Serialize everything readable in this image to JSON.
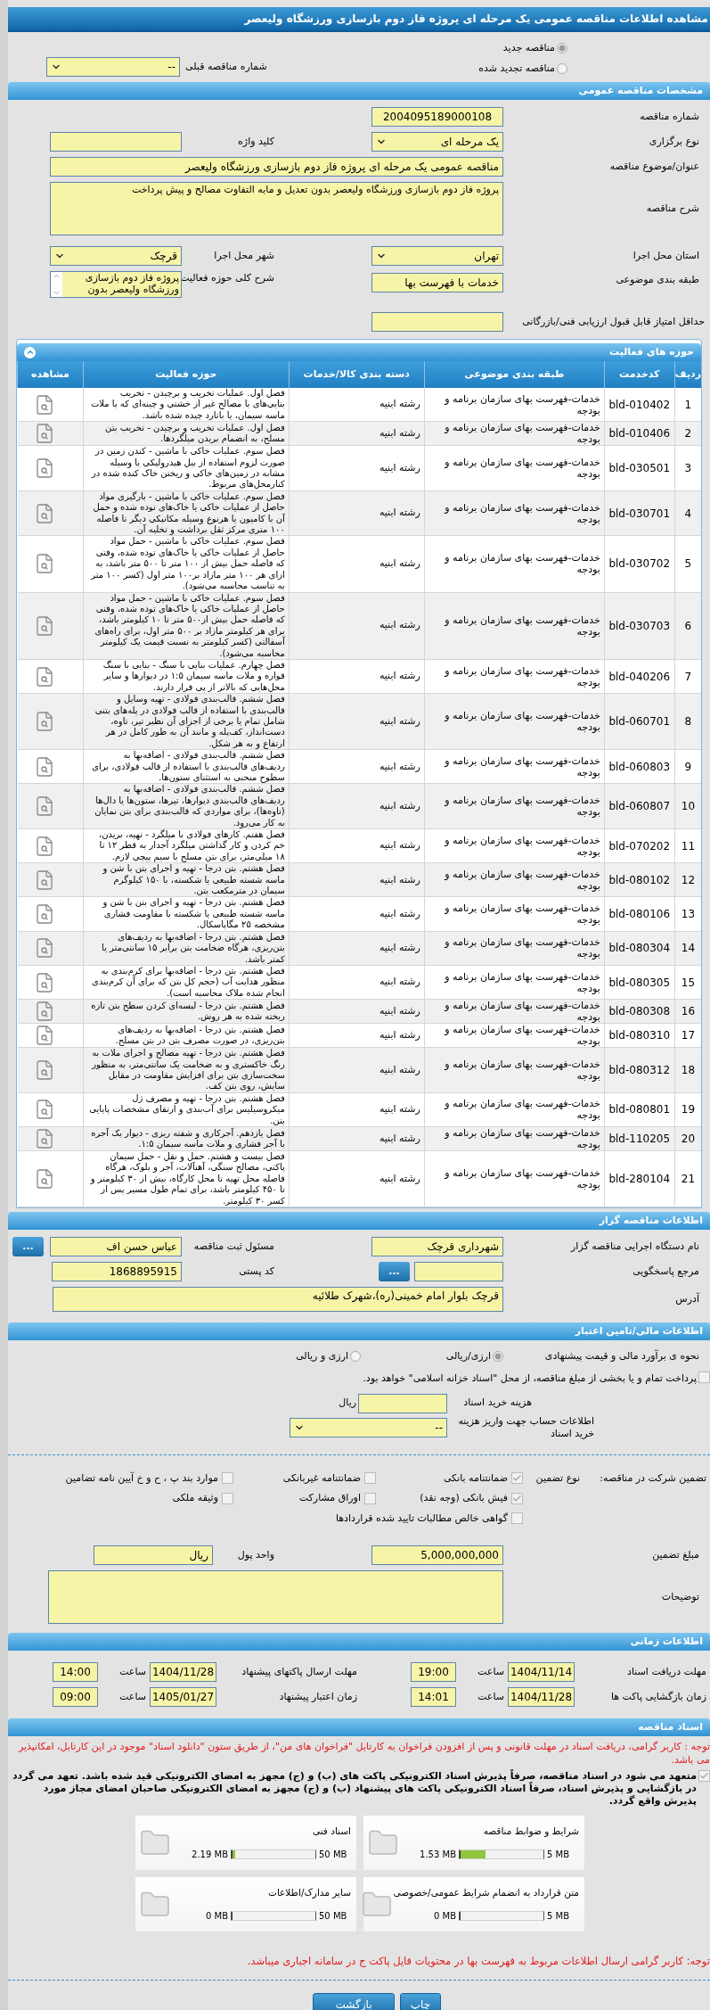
{
  "page_title": "مشاهده اطلاعات مناقصه عمومی یک مرحله ای پروژه فاز دوم بازسازی ورزشگاه ولیعصر",
  "tender_type": {
    "options": [
      {
        "label": "مناقصه جدید",
        "selected": true
      },
      {
        "label": "مناقصه تجدید شده",
        "selected": false
      }
    ],
    "previous": {
      "label": "شماره مناقصه قبلی",
      "value": "--"
    }
  },
  "general": {
    "title": "مشخصات مناقصه عمومی",
    "tender_number": {
      "label": "شماره مناقصه",
      "value": "2004095189000108"
    },
    "holding_type": {
      "label": "نوع برگزاری",
      "value": "یک مرحله ای"
    },
    "keyword": {
      "label": "کلید واژه"
    },
    "subject": {
      "label": "عنوان/موضوع مناقصه",
      "value": "مناقصه عمومی یک مرحله ای پروژه فاز دوم بازسازی ورزشگاه ولیعصر"
    },
    "description": {
      "label": "شرح مناقصه",
      "value": "پروژه فاز دوم بازسازی ورزشگاه ولیعصر بدون تعدیل و مابه التفاوت مصالح و پیش پرداخت"
    },
    "province": {
      "label": "استان محل اجرا",
      "value": "تهران"
    },
    "city": {
      "label": "شهر محل اجرا",
      "value": "قرچک"
    },
    "category": {
      "label": "طبقه بندی موضوعی",
      "value": "خدمات با فهرست بها"
    },
    "scope": {
      "label": "شرح کلی حوزه فعالیت",
      "value": "پروژه فاز دوم بازسازی ورزشگاه ولیعصر بدون"
    },
    "min_score": {
      "label": "حداقل امتیاز قابل قبول ارزیابی فنی/بازرگانی"
    }
  },
  "activities": {
    "title": "حوزه های فعالیت",
    "columns": [
      "ردیف",
      "کدخدمت",
      "طبقه بندی موضوعی",
      "دسته بندی کالا/خدمات",
      "حوزه فعالیت",
      "مشاهده"
    ],
    "rows": [
      [
        "1",
        "bld-010402",
        "خدمات-فهرست بهای سازمان برنامه و بودجه",
        "رشته ابنیه",
        "فصل اول. عملیات تخریب و برچیدن - تخریب بنایی‌های با مصالح غیر از خشتی و چینه‌ای که با ملات ماسه سیمان، یا باتارد چیده شده باشد."
      ],
      [
        "2",
        "bld-010406",
        "خدمات-فهرست بهای سازمان برنامه و بودجه",
        "رشته ابنیه",
        "فصل اول. عملیات تخریب و برچیدن - تخریب بتن مسلح، به انضمام بریدن میلگردها."
      ],
      [
        "3",
        "bld-030501",
        "خدمات-فهرست بهای سازمان برنامه و بودجه",
        "رشته ابنیه",
        "فصل سوم. عملیات خاکی با ماشین - کندن زمین در صورت لزوم استفاده از بیل هیدرولیکی یا  وسیله مشابه در زمین‌های خاکی و ریختن خاک کنده شده در کنارمحل‌های مربوط."
      ],
      [
        "4",
        "bld-030701",
        "خدمات-فهرست بهای سازمان برنامه و بودجه",
        "رشته ابنیه",
        "فصل سوم. عملیات خاکی با ماشین - بارگیری مواد حاصل از عملیات خاکی یا خاک‌های توده شده و حمل آن با کامیون یا هرنوع وسیله مکانیکی دیگر تا فاصله ۱۰۰ متری مرکز ثقل  برداشت و تخلیه آن."
      ],
      [
        "5",
        "bld-030702",
        "خدمات-فهرست بهای سازمان برنامه و بودجه",
        "رشته ابنیه",
        "فصل سوم. عملیات خاکی با ماشین - حمل مواد حاصل از عملیات خاکی یا خاک‌های توده شده، وقتی که فاصله حمل بیش از ۱۰۰ متر تا ۵۰۰ متر باشد، به ازای هر ۱۰۰ متر مازاد بر۱۰۰ متر اول (کسر ۱۰۰ متر به تناسب محاسبه می‌شود)."
      ],
      [
        "6",
        "bld-030703",
        "خدمات-فهرست بهای سازمان برنامه و بودجه",
        "رشته ابنیه",
        "فصل سوم. عملیات خاکی با ماشین - حمل مواد حاصل از عملیات خاکی یا خاک‌های توده شده، وقتی  که فاصله حمل بیش از۵۰۰ متر تا ۱۰ کیلومتر باشد، برای هر کیلومتر مازاد بر ۵۰۰  متر اول، برای راه‌های آسفالتی (کسر کیلومتر به نسبت قیمت یک کیلومتر محاسبه می‌شود)."
      ],
      [
        "7",
        "bld-040206",
        "خدمات-فهرست بهای سازمان برنامه و بودجه",
        "رشته ابنیه",
        "فصل چهارم. عملیات بنایی با سنگ - بنایی با سنگ قواره و ملات ماسه سیمان ۱:۵ در دیوارها و سایر محل‌هایی که بالاتر از پی قرار دارند."
      ],
      [
        "8",
        "bld-060701",
        "خدمات-فهرست بهای سازمان برنامه و بودجه",
        "رشته ابنیه",
        "فصل ششم. قالب‌بندی فولادی - تهیه وسایل و قالب‌بندی با استفاده از قالب فولادی در پله‌های بتنی شامل تمام یا برخی از اجزای آن نظیر تیر، تاوه، دست‌انداز، کف‌پله و مانند آن به طور کامل در هر ارتفاع و به هر شکل."
      ],
      [
        "9",
        "bld-060803",
        "خدمات-فهرست بهای سازمان برنامه و بودجه",
        "رشته ابنیه",
        "فصل ششم. قالب‌بندی فولادی - اضافه‌بها به ردیف‌های قالب‌بندی با استفاده از قالب فولادی، برای سطوح منحنی به استثنای ستون‌ها."
      ],
      [
        "10",
        "bld-060807",
        "خدمات-فهرست بهای سازمان برنامه و بودجه",
        "رشته ابنیه",
        "فصل ششم. قالب‌بندی فولادی - اضافه‌بها به ردیف‌های قالب‌بندی دیوارها، تیرها، ستون‌ها  یا دال‌ها (تاوه‌ها)، برای مواردی که قالب‌بندی برای بتن نمایان به کار می‌رود."
      ],
      [
        "11",
        "bld-070202",
        "خدمات-فهرست بهای سازمان برنامه و بودجه",
        "رشته ابنیه",
        "فصل هفتم. کارهای فولادی با میلگرد - تهیه، بریدن، خم کردن و کار گذاشتن میلگرد آجدار به قطر ۱۲ تا ۱۸ میلی‌متر، برای بتن مسلح با سیم پیچی لازم."
      ],
      [
        "12",
        "bld-080102",
        "خدمات-فهرست بهای سازمان برنامه و بودجه",
        "رشته ابنیه",
        "فصل هشتم. بتن درجا - تهیه و اجرای بتن با شن و ماسه شسته طبیعی یا شکسته، با ۱۵۰ کیلوگرم سیمان در مترمکعب بتن."
      ],
      [
        "13",
        "bld-080106",
        "خدمات-فهرست بهای سازمان برنامه و بودجه",
        "رشته ابنیه",
        "فصل هشتم. بتن درجا - تهیه و اجرای بتن با شن و ماسه شسته طبیعی یا شکسته با مقاومت فشاری مشخصه ۲۵ مگاپاسکال."
      ],
      [
        "14",
        "bld-080304",
        "خدمات-فهرست بهای سازمان برنامه و بودجه",
        "رشته ابنیه",
        "فصل هشتم. بتن درجا - اضافه‌بها به ردیف‌های بتن‌ریزی، هرگاه ضخامت بتن برابر ۱۵ سانتی‌متر یا کمتر باشد."
      ],
      [
        "15",
        "bld-080305",
        "خدمات-فهرست بهای سازمان برنامه و بودجه",
        "رشته ابنیه",
        "فصل هشتم. بتن درجا - اضافه‌بها برای کرم‌بندی به منظور هدایت آب (حجم کل بتن که برای آن کرم‌بندی انجام شده ملاک محاسبه است)."
      ],
      [
        "16",
        "bld-080308",
        "خدمات-فهرست بهای سازمان برنامه و بودجه",
        "رشته ابنیه",
        "فصل هشتم. بتن درجا - لیسه‌ای کردن سطح بتن تازه ریخته شده به هر روش."
      ],
      [
        "17",
        "bld-080310",
        "خدمات-فهرست بهای سازمان برنامه و بودجه",
        "رشته ابنیه",
        "فصل هشتم. بتن درجا - اضافه‌بها به ردیف‌های بتن‌ریزی، در صورت مصرف بتن در بتن مسلح."
      ],
      [
        "18",
        "bld-080312",
        "خدمات-فهرست بهای سازمان برنامه و بودجه",
        "رشته ابنیه",
        "فصل هشتم. بتن درجا - تهیه مصالح و اجرای ملات به رنگ خاکستری و به ضخامت یک سانتی‌متر، به منظور سخت‌سازی بتن برای افزایش مقاومت در مقابل سایش، روی بتن کف."
      ],
      [
        "19",
        "bld-080801",
        "خدمات-فهرست بهای سازمان برنامه و بودجه",
        "رشته ابنیه",
        "فصل هشتم. بتن درجا - تهیه و مصرف ژل میکروسیلیس برای آب‌بندی و ارتقای مشخصات پایایی بتن."
      ],
      [
        "20",
        "bld-110205",
        "خدمات-فهرست بهای سازمان برنامه و بودجه",
        "رشته ابنیه",
        "فصل یازدهم. آجرکاری و شفته ریزی - دیوار یک آجره با آجر فشاری و ملات ماسه سیمان ۱:۵."
      ],
      [
        "21",
        "bld-280104",
        "خدمات-فهرست بهای سازمان برنامه و بودجه",
        "رشته ابنیه",
        "فصل بیست و هشتم. حمل و نقل - حمل سیمان پاکتی، مصالح سنگی، آهنآلات، آجر و بلوک، هرگاه فاصله محل تهیه تا محل کارگاه، بیش از ۳۰ کیلومتر و تا ۴۵۰ کیلومتر باشد، برای تمام طول مسیر پس از کسر ۳۰ کیلومتر."
      ]
    ]
  },
  "organizer": {
    "title": "اطلاعات مناقصه گزار",
    "org_name": {
      "label": "نام دستگاه اجرایی مناقصه گزار",
      "value": "شهرداری قرچک"
    },
    "registrar": {
      "label": "مسئول ثبت مناقصه",
      "value": "عباس حسن اف",
      "button": "..."
    },
    "responder": {
      "label": "مرجع پاسخگویی",
      "button": "..."
    },
    "postal_code": {
      "label": "کد پستی",
      "value": "1868895915"
    },
    "address": {
      "label": "آدرس",
      "value": "قرچک بلوار امام خمینی(ره)،شهرک طلائیه"
    }
  },
  "finance": {
    "title": "اطلاعات مالی/تامین اعتبار",
    "estimate": {
      "label": "نحوه ی برآورد مالی و قیمت پیشنهادی",
      "options": [
        {
          "label": "ارزی/ریالی",
          "selected": true
        },
        {
          "label": "ارزی و ریالی",
          "selected": false
        }
      ]
    },
    "treasury": {
      "label": "پرداخت تمام و یا بخشی از مبلغ مناقصه، از محل \"اسناد خزانه اسلامی\" خواهد بود.",
      "checked": false
    },
    "doc_cost": {
      "label": "هزینه خرید اسناد",
      "unit": "ریال"
    },
    "account": {
      "label": "اطلاعات حساب جهت واریز هزینه خرید اسناد",
      "value": "--"
    },
    "guarantee": {
      "label": "تضمین شرکت در مناقصه:",
      "type_label": "نوع تضمین",
      "options": [
        {
          "label": "ضمانتنامه بانکی",
          "checked": true
        },
        {
          "label": "ضمانتنامه غیربانکی",
          "checked": false
        },
        {
          "label": "موارد بند پ ، ح و خ آیین نامه تضامین",
          "checked": false
        },
        {
          "label": "فیش بانکی (وجه نقد)",
          "checked": true
        },
        {
          "label": "اوراق مشارکت",
          "checked": false
        },
        {
          "label": "وثیقه ملکی",
          "checked": false
        },
        {
          "label": "گواهی خالص مطالبات تایید شده قراردادها",
          "checked": false
        }
      ]
    },
    "amount": {
      "label": "مبلغ تضمین",
      "value": "5,000,000,000"
    },
    "currency": {
      "label": "واحد پول",
      "value": "ریال"
    },
    "notes": {
      "label": "توضیحات"
    }
  },
  "timing": {
    "title": "اطلاعات زمانی",
    "items": [
      {
        "label": "مهلت دریافت اسناد",
        "date": "1404/11/14",
        "time_label": "ساعت",
        "time": "19:00"
      },
      {
        "label": "مهلت ارسال پاکتهای پیشنهاد",
        "date": "1404/11/28",
        "time_label": "ساعت",
        "time": "14:00"
      },
      {
        "label": "زمان بازگشایی پاکت ها",
        "date": "1404/11/28",
        "time_label": "ساعت",
        "time": "14:01"
      },
      {
        "label": "زمان اعتبار پیشنهاد",
        "date": "1405/01/27",
        "time_label": "ساعت",
        "time": "09:00"
      }
    ]
  },
  "documents": {
    "title": "اسناد مناقصه",
    "notice": "توجه : کاربر گرامی، دریافت اسناد در مهلت قانونی و پس از افزودن فراخوان به کارتابل \"فراخوان های من\"، از طریق ستون \"دانلود اسناد\" موجود در این کارتابل، امکانپذیر می باشد.",
    "commitment": {
      "checked": true,
      "text": "متعهد می شود در اسناد مناقصه، صرفاً پذیرش اسناد الکترونیکی پاکت های (ب) و (ج) مجهز به امضای الکترونیکی قید شده باشد. تعهد می گردد در بازگشایی و پذیرش اسناد، صرفاً اسناد الکترونیکی پاکت های پیشنهاد (ب) و (ج) مجهز به امضای الکترونیکی صاحبان امضای مجاز مورد پذیرش واقع گردد."
    },
    "files": [
      {
        "title": "شرایط و ضوابط مناقصه",
        "max": "5 MB",
        "size": "1.53 MB",
        "level": 0.306
      },
      {
        "title": "اسناد فنی",
        "max": "50 MB",
        "size": "2.19 MB",
        "level": 0.044
      },
      {
        "title": "متن قرارداد به انضمام شرایط عمومی/خصوصی",
        "max": "5 MB",
        "size": "0 MB",
        "level": 0
      },
      {
        "title": "سایر مدارک/اطلاعات",
        "max": "50 MB",
        "size": "0 MB",
        "level": 0
      }
    ],
    "footer_notice": "توجه: کاربر گرامی ارسال اطلاعات مربوط به فهرست بها در محتویات فایل پاکت ج در سامانه اجباری میباشد."
  },
  "buttons": [
    "چاپ",
    "بازگشت"
  ]
}
